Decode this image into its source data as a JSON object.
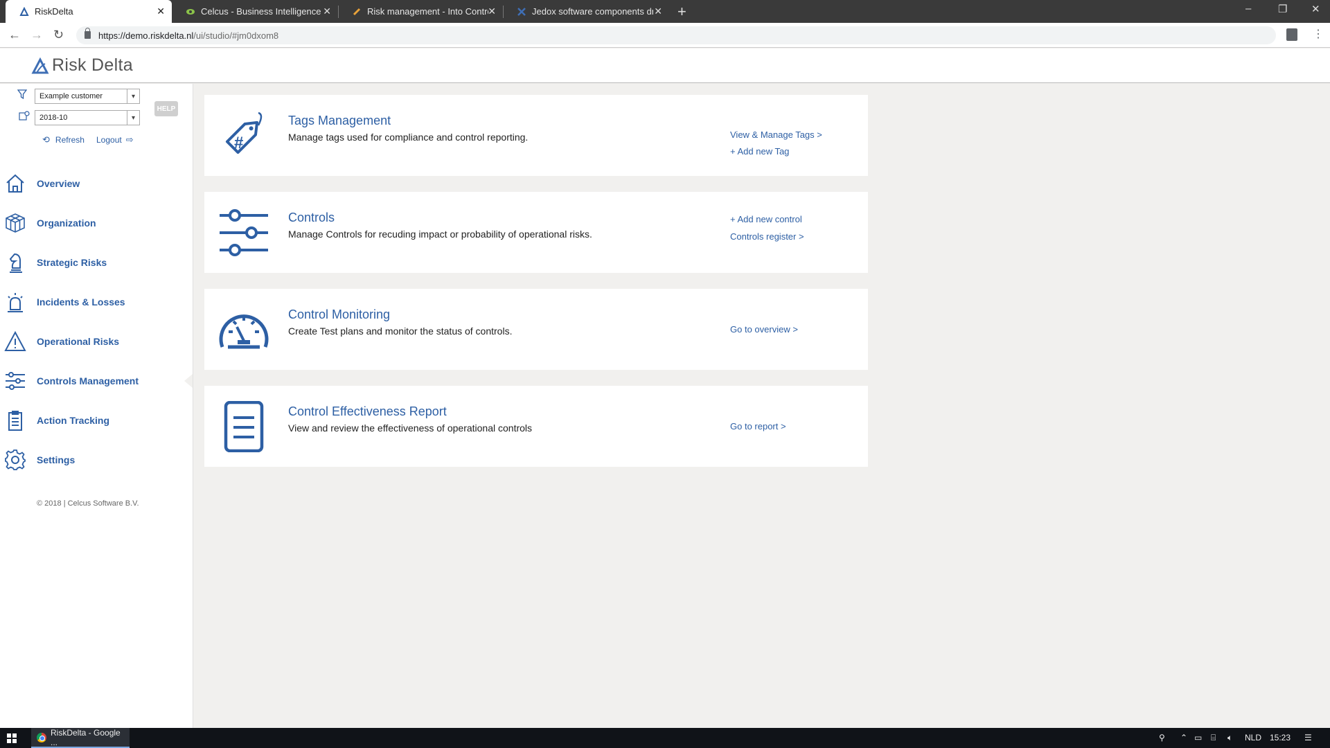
{
  "browser": {
    "tabs": [
      {
        "title": "RiskDelta",
        "active": true
      },
      {
        "title": "Celcus - Business Intelligence en",
        "active": false
      },
      {
        "title": "Risk management - Into Control",
        "active": false
      },
      {
        "title": "Jedox software components drive",
        "active": false
      }
    ],
    "url_host": "https://demo.riskdelta.nl",
    "url_path": "/ui/studio/#jm0dxom8"
  },
  "app": {
    "logo_text": "Risk Delta",
    "accent_color": "#2d5fa4"
  },
  "sidebar": {
    "customer_select": "Example customer",
    "period_select": "2018-10",
    "help_label": "HELP",
    "refresh_label": "Refresh",
    "logout_label": "Logout",
    "nav": [
      {
        "label": "Overview",
        "icon": "home-icon"
      },
      {
        "label": "Organization",
        "icon": "cube-icon"
      },
      {
        "label": "Strategic Risks",
        "icon": "chess-knight-icon"
      },
      {
        "label": "Incidents & Losses",
        "icon": "alarm-light-icon"
      },
      {
        "label": "Operational Risks",
        "icon": "warning-icon"
      },
      {
        "label": "Controls Management",
        "icon": "sliders-icon",
        "active": true
      },
      {
        "label": "Action Tracking",
        "icon": "clipboard-icon"
      },
      {
        "label": "Settings",
        "icon": "gear-icon"
      }
    ],
    "copyright": "© 2018 | Celcus Software B.V."
  },
  "cards": [
    {
      "title": "Tags Management",
      "description": "Manage tags used for compliance and control reporting.",
      "icon": "tag-icon",
      "links": [
        "View & Manage Tags >",
        "+ Add new Tag"
      ]
    },
    {
      "title": "Controls",
      "description": "Manage Controls for recuding impact or probability of operational risks.",
      "icon": "sliders-icon",
      "links": [
        "+ Add new control",
        "Controls register >"
      ]
    },
    {
      "title": "Control Monitoring",
      "description": "Create Test plans and monitor the status of controls.",
      "icon": "speedometer-icon",
      "links": [
        "Go to overview >"
      ]
    },
    {
      "title": "Control Effectiveness Report",
      "description": "View and review the effectiveness of operational controls",
      "icon": "document-icon",
      "links": [
        "Go to report >"
      ]
    }
  ],
  "taskbar": {
    "app_label": "RiskDelta - Google ...",
    "language": "NLD",
    "time": "15:23"
  }
}
